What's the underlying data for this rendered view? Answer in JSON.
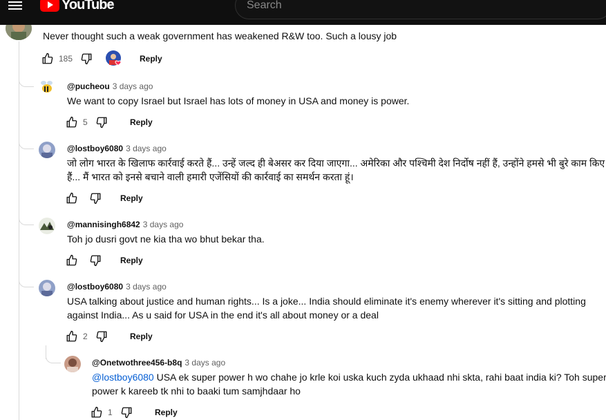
{
  "header": {
    "logo_text": "YouTube",
    "country_code": "IN",
    "search_placeholder": "Search"
  },
  "top_comment": {
    "text": "Never thought such a weak government has weakened R&W too. Such a lousy job",
    "like_count": "185",
    "reply_label": "Reply"
  },
  "replies": [
    {
      "author": "@pucheou",
      "time": "3 days ago",
      "text": "We want to copy Israel but Israel has lots of money in USA and money is power.",
      "like_count": "5",
      "reply_label": "Reply"
    },
    {
      "author": "@lostboy6080",
      "time": "3 days ago",
      "text": "जो लोग भारत के खिलाफ कार्रवाई करते हैं... उन्हें जल्द ही बेअसर कर दिया जाएगा... अमेरिका और पश्चिमी देश निर्दोष नहीं हैं, उन्होंने हमसे भी बुरे काम किए हैं... मैं भारत को इनसे बचाने वाली हमारी एजेंसियों की कार्रवाई का समर्थन करता हूं।",
      "reply_label": "Reply"
    },
    {
      "author": "@mannisingh6842",
      "time": "3 days ago",
      "text": "Toh jo dusri govt ne kia tha wo bhut bekar tha.",
      "reply_label": "Reply"
    },
    {
      "author": "@lostboy6080",
      "time": "3 days ago",
      "text": "USA talking about justice and human rights... Is a joke... India should eliminate it's enemy wherever it's sitting and plotting against India... As u said for USA in the end it's all about money or a deal",
      "like_count": "2",
      "reply_label": "Reply"
    },
    {
      "author": "@Onetwothree456-b8q",
      "time": "3 days ago",
      "mention": "@lostboy6080",
      "text": " USA ek super power h wo chahe jo krle koi uska kuch zyda ukhaad nhi skta, rahi baat india ki? Toh super power k kareeb tk nhi to baaki tum samjhdaar ho",
      "like_count": "1",
      "reply_label": "Reply"
    }
  ],
  "colors": {
    "header_bg": "#0f0f0f",
    "brand_red": "#ff0000",
    "mention_blue": "#065fd4",
    "meta_gray": "#606060"
  }
}
